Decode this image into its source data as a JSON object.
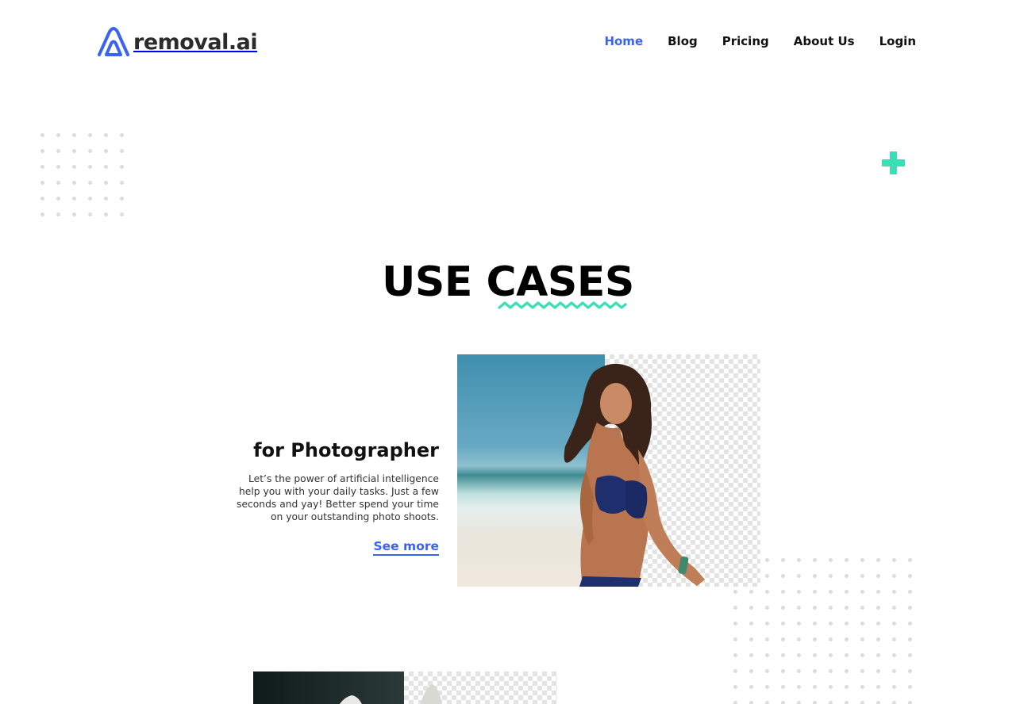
{
  "brand": {
    "name": "removal.ai",
    "logo_color": "#3b63f2",
    "accent_color": "#38e0b4"
  },
  "nav": {
    "items": [
      {
        "label": "Home",
        "active": true
      },
      {
        "label": "Blog",
        "active": false
      },
      {
        "label": "Pricing",
        "active": false
      },
      {
        "label": "About Us",
        "active": false
      },
      {
        "label": "Login",
        "active": false
      }
    ]
  },
  "section": {
    "title": "USE CASES"
  },
  "use_case": {
    "heading": "for Photographer",
    "description": "Let’s the power of artificial intelligence help you with your daily tasks. Just a few seconds and yay! Better spend your time on your outstanding photo shoots.",
    "link_label": "See more"
  },
  "icons": [
    "logo-mark-icon",
    "plus-icon",
    "squiggle-underline"
  ]
}
